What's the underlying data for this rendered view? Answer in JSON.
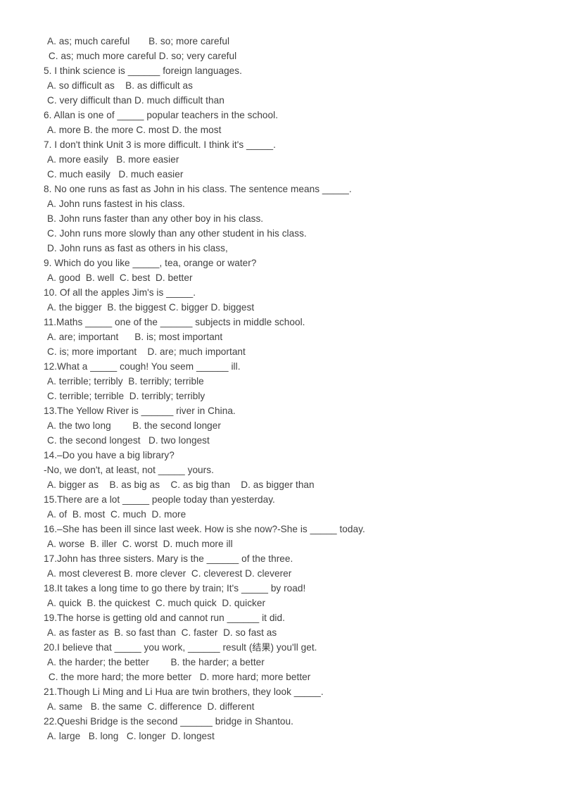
{
  "document": {
    "type": "grammar-exercise-worksheet",
    "background_color": "#ffffff",
    "text_color": "#3f3f3f",
    "lines": [
      {
        "id": "l01",
        "kind": "options",
        "indent": "indent",
        "text": "A. as; much careful       B. so; more careful"
      },
      {
        "id": "l02",
        "kind": "options",
        "indent": "indent2",
        "text": " C. as; much more careful D. so; very careful"
      },
      {
        "id": "l03",
        "kind": "question",
        "indent": "",
        "text": "5. I think science is ______ foreign languages."
      },
      {
        "id": "l04",
        "kind": "options",
        "indent": "indent",
        "text": "A. so difficult as    B. as difficult as"
      },
      {
        "id": "l05",
        "kind": "options",
        "indent": "indent",
        "text": "C. very difficult than D. much difficult than"
      },
      {
        "id": "l06",
        "kind": "question",
        "indent": "",
        "text": "6. Allan is one of _____ popular teachers in the school."
      },
      {
        "id": "l07",
        "kind": "options",
        "indent": "indent",
        "text": "A. more B. the more C. most D. the most"
      },
      {
        "id": "l08",
        "kind": "question",
        "indent": "",
        "text": "7. I don't think Unit 3 is more difficult. I think it's _____."
      },
      {
        "id": "l09",
        "kind": "options",
        "indent": "indent",
        "text": "A. more easily   B. more easier"
      },
      {
        "id": "l10",
        "kind": "options",
        "indent": "indent",
        "text": "C. much easily   D. much easier"
      },
      {
        "id": "l11",
        "kind": "question",
        "indent": "",
        "text": "8. No one runs as fast as John in his class. The sentence means _____."
      },
      {
        "id": "l12",
        "kind": "options",
        "indent": "indent",
        "text": "A. John runs fastest in his class."
      },
      {
        "id": "l13",
        "kind": "options",
        "indent": "indent",
        "text": "B. John runs faster than any other boy in his class."
      },
      {
        "id": "l14",
        "kind": "options",
        "indent": "indent",
        "text": "C. John runs more slowly than any other student in his class."
      },
      {
        "id": "l15",
        "kind": "options",
        "indent": "indent",
        "text": "D. John runs as fast as others in his class,"
      },
      {
        "id": "l16",
        "kind": "question",
        "indent": "",
        "text": "9. Which do you like _____, tea, orange or water?"
      },
      {
        "id": "l17",
        "kind": "options",
        "indent": "indent",
        "text": "A. good  B. well  C. best  D. better"
      },
      {
        "id": "l18",
        "kind": "question",
        "indent": "",
        "text": "10. Of all the apples Jim's is _____."
      },
      {
        "id": "l19",
        "kind": "options",
        "indent": "indent",
        "text": "A. the bigger  B. the biggest C. bigger D. biggest"
      },
      {
        "id": "l20",
        "kind": "question",
        "indent": "",
        "text": "11.Maths _____ one of the ______ subjects in middle school."
      },
      {
        "id": "l21",
        "kind": "options",
        "indent": "indent",
        "text": "A. are; important      B. is; most important"
      },
      {
        "id": "l22",
        "kind": "options",
        "indent": "indent",
        "text": "C. is; more important    D. are; much important"
      },
      {
        "id": "l23",
        "kind": "question",
        "indent": "",
        "text": "12.What a _____ cough! You seem ______ ill."
      },
      {
        "id": "l24",
        "kind": "options",
        "indent": "indent",
        "text": "A. terrible; terribly  B. terribly; terrible"
      },
      {
        "id": "l25",
        "kind": "options",
        "indent": "indent",
        "text": "C. terrible; terrible  D. terribly; terribly"
      },
      {
        "id": "l26",
        "kind": "question",
        "indent": "",
        "text": "13.The Yellow River is ______ river in China."
      },
      {
        "id": "l27",
        "kind": "options",
        "indent": "indent",
        "text": "A. the two long        B. the second longer"
      },
      {
        "id": "l28",
        "kind": "options",
        "indent": "indent",
        "text": "C. the second longest   D. two longest"
      },
      {
        "id": "l29",
        "kind": "question",
        "indent": "",
        "text": "14.–Do you have a big library?"
      },
      {
        "id": "l30",
        "kind": "question",
        "indent": "",
        "text": "-No, we don't, at least, not _____ yours."
      },
      {
        "id": "l31",
        "kind": "options",
        "indent": "indent",
        "text": "A. bigger as    B. as big as    C. as big than    D. as bigger than"
      },
      {
        "id": "l32",
        "kind": "question",
        "indent": "",
        "text": "15.There are a lot _____ people today than yesterday."
      },
      {
        "id": "l33",
        "kind": "options",
        "indent": "indent",
        "text": "A. of  B. most  C. much  D. more"
      },
      {
        "id": "l34",
        "kind": "question",
        "indent": "",
        "text": "16.–She has been ill since last week. How is she now?-She is _____ today."
      },
      {
        "id": "l35",
        "kind": "options",
        "indent": "indent",
        "text": "A. worse  B. iller  C. worst  D. much more ill"
      },
      {
        "id": "l36",
        "kind": "question",
        "indent": "",
        "text": "17.John has three sisters. Mary is the ______ of the three."
      },
      {
        "id": "l37",
        "kind": "options",
        "indent": "indent",
        "text": "A. most cleverest B. more clever  C. cleverest D. cleverer"
      },
      {
        "id": "l38",
        "kind": "question",
        "indent": "",
        "text": "18.It takes a long time to go there by train; It's _____ by road!"
      },
      {
        "id": "l39",
        "kind": "options",
        "indent": "indent",
        "text": "A. quick  B. the quickest  C. much quick  D. quicker"
      },
      {
        "id": "l40",
        "kind": "question",
        "indent": "",
        "text": "19.The horse is getting old and cannot run ______ it did."
      },
      {
        "id": "l41",
        "kind": "options",
        "indent": "indent",
        "text": "A. as faster as  B. so fast than  C. faster  D. so fast as"
      },
      {
        "id": "l42",
        "kind": "question",
        "indent": "",
        "text": "20.I believe that _____ you work, ______ result (结果) you'll get."
      },
      {
        "id": "l43",
        "kind": "options",
        "indent": "indent",
        "text": "A. the harder; the better        B. the harder; a better"
      },
      {
        "id": "l44",
        "kind": "options",
        "indent": "indent2",
        "text": " C. the more hard; the more better   D. more hard; more better"
      },
      {
        "id": "l45",
        "kind": "question",
        "indent": "",
        "text": "21.Though Li Ming and Li Hua are twin brothers, they look _____."
      },
      {
        "id": "l46",
        "kind": "options",
        "indent": "indent",
        "text": "A. same   B. the same  C. difference  D. different"
      },
      {
        "id": "l47",
        "kind": "question",
        "indent": "",
        "text": "22.Queshi Bridge is the second ______ bridge in Shantou."
      },
      {
        "id": "l48",
        "kind": "options",
        "indent": "indent",
        "text": "A. large   B. long   C. longer  D. longest"
      }
    ]
  }
}
